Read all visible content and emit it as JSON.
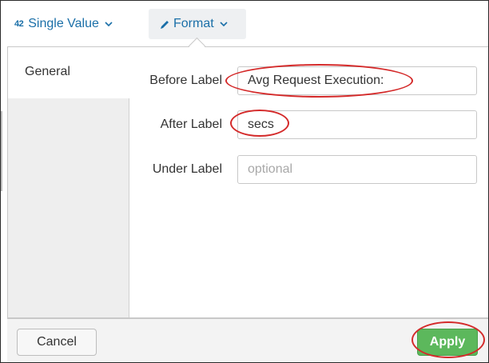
{
  "toolbar": {
    "viz_icon": "42",
    "viz_label": "Single Value",
    "format_label": "Format",
    "accent_color": "#1a6fa8"
  },
  "sidebar": {
    "items": [
      {
        "label": "General",
        "selected": true
      }
    ]
  },
  "form": {
    "before_label": {
      "label": "Before Label",
      "value": "Avg Request Execution:"
    },
    "after_label": {
      "label": "After Label",
      "value": "secs"
    },
    "under_label": {
      "label": "Under Label",
      "value": "",
      "placeholder": "optional"
    }
  },
  "footer": {
    "cancel_label": "Cancel",
    "apply_label": "Apply",
    "apply_color": "#5cb85c"
  },
  "annotation_color": "#d42a2a"
}
